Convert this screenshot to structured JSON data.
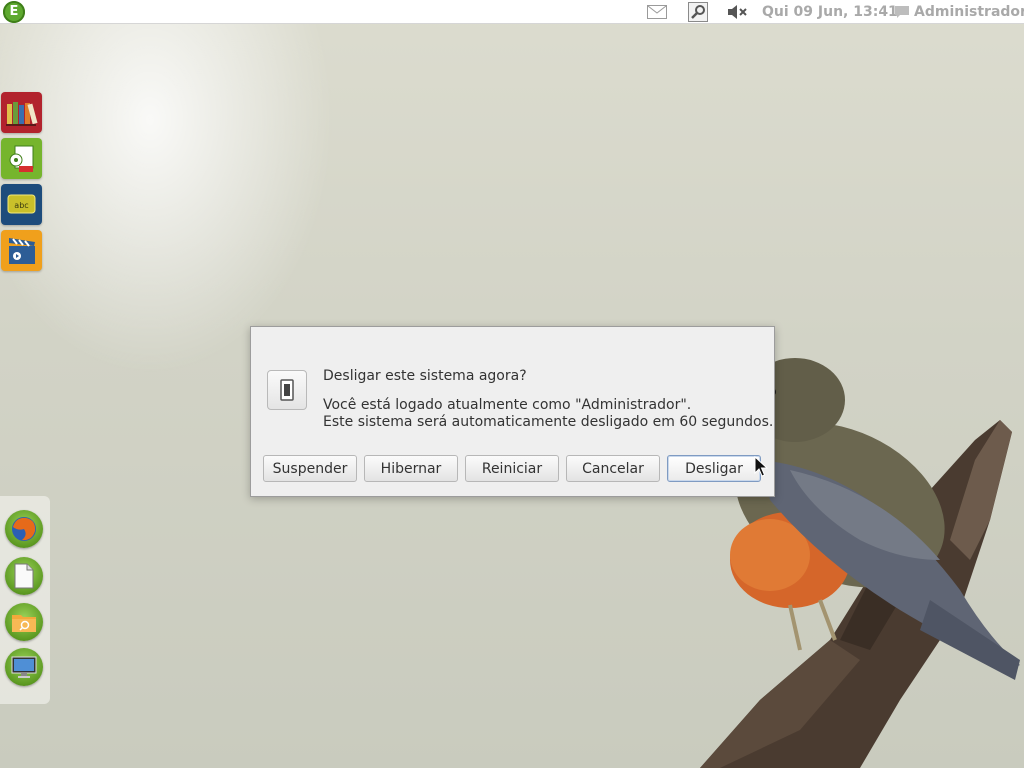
{
  "top_panel": {
    "clock": "Qui 09 Jun, 13:41",
    "user": "Administrador",
    "icons": [
      "launcher-logo-icon",
      "mail-icon",
      "search-icon",
      "volume-muted-icon",
      "chat-icon"
    ]
  },
  "launcher": {
    "top_tiles": [
      {
        "name": "books-app-icon",
        "color": "#b2232d"
      },
      {
        "name": "media-docs-app-icon",
        "color": "#76b52d"
      },
      {
        "name": "abc-app-icon",
        "color": "#1d4c7c"
      },
      {
        "name": "video-app-icon",
        "color": "#f0a01c"
      }
    ],
    "dock": [
      "firefox-icon",
      "document-icon",
      "file-manager-icon",
      "display-icon"
    ]
  },
  "dialog": {
    "title": "Desligar este sistema agora?",
    "message_line1": "Você está logado atualmente como \"Administrador\".",
    "message_line2": "Este sistema será automaticamente desligado em 60 segundos.",
    "buttons": {
      "suspend": "Suspender",
      "hibernate": "Hibernar",
      "restart": "Reiniciar",
      "cancel": "Cancelar",
      "shutdown": "Desligar"
    }
  }
}
